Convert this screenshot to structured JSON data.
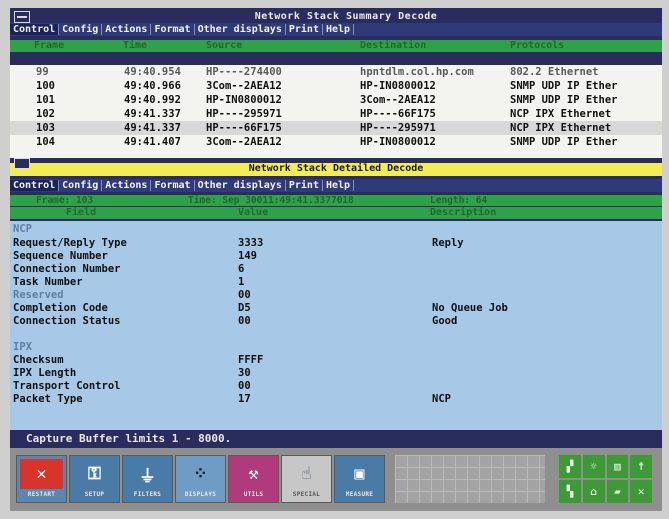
{
  "summary": {
    "title": "Network Stack Summary Decode",
    "menu": [
      "Control",
      "Config",
      "Actions",
      "Format",
      "Other displays",
      "Print",
      "Help"
    ],
    "columns": [
      "Frame",
      "Time",
      "Source",
      "Destination",
      "Protocols"
    ],
    "rows": [
      {
        "frame": "99",
        "time": "49:40.954",
        "source": "HP----274400",
        "destination": "hpntdlm.col.hp.com",
        "protocols": "802.2 Ethernet"
      },
      {
        "frame": "100",
        "time": "49:40.966",
        "source": "3Com--2AEA12",
        "destination": "HP-IN0800012",
        "protocols": "SNMP UDP IP Ether"
      },
      {
        "frame": "101",
        "time": "49:40.992",
        "source": "HP-IN0800012",
        "destination": "3Com--2AEA12",
        "protocols": "SNMP UDP IP Ether"
      },
      {
        "frame": "102",
        "time": "49:41.337",
        "source": "HP----295971",
        "destination": "HP----66F175",
        "protocols": "NCP IPX Ethernet"
      },
      {
        "frame": "103",
        "time": "49:41.337",
        "source": "HP----66F175",
        "destination": "HP----295971",
        "protocols": "NCP IPX Ethernet"
      },
      {
        "frame": "104",
        "time": "49:41.407",
        "source": "3Com--2AEA12",
        "destination": "HP-IN0800012",
        "protocols": "SNMP UDP IP Ether"
      }
    ]
  },
  "detail": {
    "title": "Network Stack Detailed Decode",
    "menu": [
      "Control",
      "Config",
      "Actions",
      "Format",
      "Other displays",
      "Print",
      "Help"
    ],
    "frame_info": "Frame: 103",
    "time_info": "Time: Sep 30011:49:41.3377018",
    "length_info": "Length: 64",
    "columns": [
      "Field",
      "Value",
      "Description"
    ],
    "section_ncp": "NCP",
    "ncp_fields": [
      {
        "field": "Request/Reply Type",
        "value": "3333",
        "desc": "Reply"
      },
      {
        "field": "Sequence Number",
        "value": "149",
        "desc": ""
      },
      {
        "field": "Connection Number",
        "value": "6",
        "desc": ""
      },
      {
        "field": "Task Number",
        "value": "1",
        "desc": ""
      },
      {
        "field": "Reserved",
        "value": "00",
        "desc": ""
      },
      {
        "field": "Completion Code",
        "value": "D5",
        "desc": "No Queue Job"
      },
      {
        "field": "Connection Status",
        "value": "00",
        "desc": "Good"
      }
    ],
    "section_ipx": "IPX",
    "ipx_fields": [
      {
        "field": "Checksum",
        "value": "FFFF",
        "desc": ""
      },
      {
        "field": "IPX Length",
        "value": "30",
        "desc": ""
      },
      {
        "field": "Transport Control",
        "value": "00",
        "desc": ""
      },
      {
        "field": "Packet Type",
        "value": "17",
        "desc": "NCP"
      }
    ],
    "status": "Capture Buffer limits 1 - 8000."
  },
  "toolbar": {
    "buttons": [
      {
        "label": "RESTART",
        "icon": "close-icon",
        "color": "#d8342b"
      },
      {
        "label": "SETUP",
        "icon": "key-icon",
        "color": "#4a7aa6"
      },
      {
        "label": "FILTERS",
        "icon": "funnel-icon",
        "color": "#4a7aa6"
      },
      {
        "label": "DISPLAYS",
        "icon": "scatter-icon",
        "color": "#4a7aa6"
      },
      {
        "label": "UTILS",
        "icon": "tools-icon",
        "color": "#b03a7a"
      },
      {
        "label": "SPECIAL",
        "icon": "hand-icon",
        "color": "#c7c7c7"
      },
      {
        "label": "MEASURE",
        "icon": "meter-icon",
        "color": "#4a7aa6"
      }
    ],
    "right_glyphs": [
      "▞",
      "☼",
      "▥",
      "☨",
      "▚",
      "⌂",
      "▰",
      "✕"
    ]
  }
}
